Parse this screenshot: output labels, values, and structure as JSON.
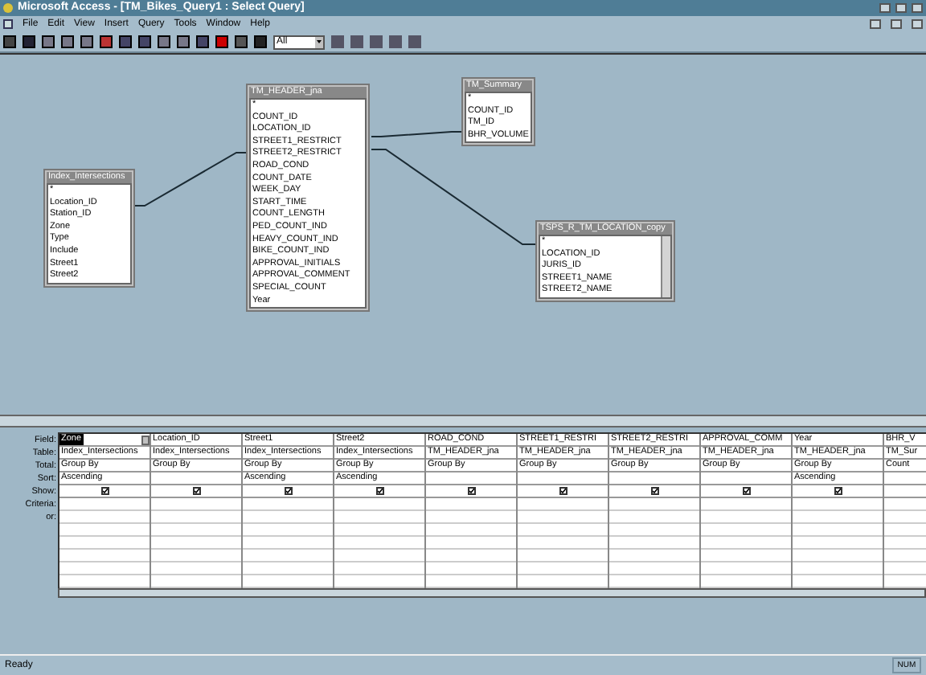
{
  "window": {
    "title": "Microsoft Access - [TM_Bikes_Query1 : Select Query]"
  },
  "menu": [
    "File",
    "Edit",
    "View",
    "Insert",
    "Query",
    "Tools",
    "Window",
    "Help"
  ],
  "toolbar": {
    "top_values": "All"
  },
  "tables": [
    {
      "title": "Index_Intersections",
      "fields": [
        "*",
        "Location_ID",
        "Station_ID",
        "Zone",
        "Type",
        "Include",
        "Street1",
        "Street2"
      ],
      "scrollbar": false
    },
    {
      "title": "TM_HEADER_jna",
      "fields": [
        "*",
        "COUNT_ID",
        "LOCATION_ID",
        "STREET1_RESTRICT",
        "STREET2_RESTRICT",
        "ROAD_COND",
        "COUNT_DATE",
        "WEEK_DAY",
        "START_TIME",
        "COUNT_LENGTH",
        "PED_COUNT_IND",
        "HEAVY_COUNT_IND",
        "BIKE_COUNT_IND",
        "APPROVAL_INITIALS",
        "APPROVAL_COMMENT",
        "SPECIAL_COUNT",
        "Year"
      ],
      "scrollbar": false
    },
    {
      "title": "TM_Summary",
      "fields": [
        "*",
        "COUNT_ID",
        "TM_ID",
        "BHR_VOLUME"
      ],
      "scrollbar": false
    },
    {
      "title": "TSPS_R_TM_LOCATION_copy",
      "fields": [
        "*",
        "LOCATION_ID",
        "JURIS_ID",
        "STREET1_NAME",
        "STREET2_NAME"
      ],
      "scrollbar": true
    }
  ],
  "grid": {
    "row_labels": [
      "Field:",
      "Table:",
      "Total:",
      "Sort:",
      "Show:",
      "Criteria:",
      "or:"
    ],
    "columns": [
      {
        "field": "Zone",
        "table": "Index_Intersections",
        "total": "Group By",
        "sort": "Ascending",
        "show": true,
        "selected": true
      },
      {
        "field": "Location_ID",
        "table": "Index_Intersections",
        "total": "Group By",
        "show": true,
        "selected": false
      },
      {
        "field": "Street1",
        "table": "Index_Intersections",
        "total": "Group By",
        "sort": "Ascending",
        "show": true,
        "selected": false
      },
      {
        "field": "Street2",
        "table": "Index_Intersections",
        "total": "Group By",
        "sort": "Ascending",
        "show": true,
        "selected": false
      },
      {
        "field": "ROAD_COND",
        "table": "TM_HEADER_jna",
        "total": "Group By",
        "show": true,
        "selected": false
      },
      {
        "field": "STREET1_RESTRI",
        "table": "TM_HEADER_jna",
        "total": "Group By",
        "show": true,
        "selected": false
      },
      {
        "field": "STREET2_RESTRI",
        "table": "TM_HEADER_jna",
        "total": "Group By",
        "show": true,
        "selected": false
      },
      {
        "field": "APPROVAL_COMM",
        "table": "TM_HEADER_jna",
        "total": "Group By",
        "show": true,
        "selected": false
      },
      {
        "field": "Year",
        "table": "TM_HEADER_jna",
        "total": "Group By",
        "sort": "Ascending",
        "show": true,
        "selected": false
      },
      {
        "field": "BHR_V",
        "table": "TM_Sur",
        "total": "Count",
        "selected": false
      }
    ]
  },
  "status_bar": {
    "text": "Ready",
    "indicator": "NUM"
  }
}
